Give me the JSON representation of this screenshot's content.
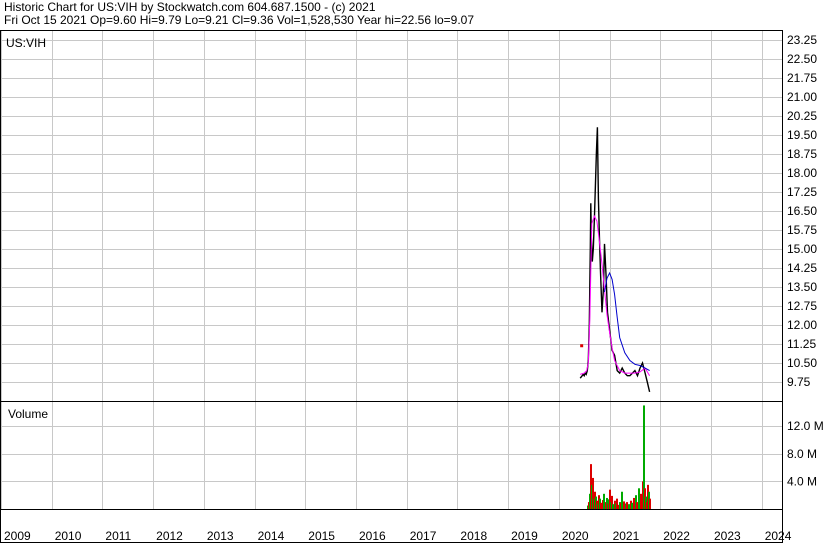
{
  "header": {
    "line1": "Historic Chart for US:VIH by Stockwatch.com 604.687.1500 - (c) 2021",
    "line2": "Fri Oct 15 2021  Op=9.60  Hi=9.79  Lo=9.21  Cl=9.36  Vol=1,528,530  Year hi=22.56  lo=9.07"
  },
  "chart_data": {
    "type": "line",
    "symbol_label": "US:VIH",
    "volume_label": "Volume",
    "x_tick_labels": [
      "2009",
      "2010",
      "2011",
      "2012",
      "2013",
      "2014",
      "2015",
      "2016",
      "2017",
      "2018",
      "2019",
      "2020",
      "2021",
      "2022",
      "2023",
      "2024"
    ],
    "y_tick_labels": [
      "23.25",
      "22.50",
      "21.75",
      "21.00",
      "20.25",
      "19.50",
      "18.75",
      "18.00",
      "17.25",
      "16.50",
      "15.75",
      "15.00",
      "14.25",
      "13.50",
      "12.75",
      "12.00",
      "11.25",
      "10.50",
      "9.75"
    ],
    "y_ticks": [
      23.25,
      22.5,
      21.75,
      21.0,
      20.25,
      19.5,
      18.75,
      18.0,
      17.25,
      16.5,
      15.75,
      15.0,
      14.25,
      13.5,
      12.75,
      12.0,
      11.25,
      10.5,
      9.75
    ],
    "ylim": [
      9.0,
      23.6
    ],
    "volume_tick_labels": [
      "12.0 M",
      "8.0 M",
      "4.0 M"
    ],
    "volume_ticks": [
      12.0,
      8.0,
      4.0
    ],
    "volume_ylim": [
      0,
      15.5
    ],
    "xlim": [
      2009.0,
      2024.4
    ],
    "grid": true,
    "colors": {
      "price": "#000000",
      "ma_short": "#ff00ff",
      "ma_long": "#0000cc",
      "volume_up": "#00aa00",
      "volume_down": "#dd0000",
      "grid": "#c8c8c8"
    },
    "series": [
      {
        "name": "price",
        "x": [
          2020.42,
          2020.44,
          2020.46,
          2020.48,
          2020.5,
          2020.52,
          2020.54,
          2020.56,
          2020.58,
          2020.6,
          2020.61,
          2020.62,
          2020.63,
          2020.64,
          2020.66,
          2020.68,
          2020.7,
          2020.72,
          2020.74,
          2020.76,
          2020.78,
          2020.8,
          2020.82,
          2020.85,
          2020.88,
          2020.9,
          2020.93,
          2020.96,
          2021.0,
          2021.05,
          2021.1,
          2021.15,
          2021.2,
          2021.25,
          2021.3,
          2021.35,
          2021.4,
          2021.45,
          2021.5,
          2021.55,
          2021.6,
          2021.65,
          2021.7,
          2021.75,
          2021.79
        ],
        "y": [
          9.9,
          9.95,
          10.0,
          10.05,
          10.0,
          10.1,
          10.05,
          10.2,
          10.6,
          12.0,
          13.5,
          15.0,
          16.8,
          15.5,
          14.5,
          15.0,
          16.2,
          17.5,
          18.8,
          19.8,
          17.0,
          15.5,
          14.2,
          12.5,
          13.5,
          15.2,
          14.0,
          12.5,
          11.8,
          11.0,
          10.8,
          10.2,
          10.1,
          10.3,
          10.1,
          10.0,
          10.0,
          10.1,
          10.2,
          10.0,
          10.3,
          10.5,
          10.1,
          9.7,
          9.36
        ]
      },
      {
        "name": "ma_short",
        "x": [
          2020.42,
          2020.5,
          2020.55,
          2020.58,
          2020.61,
          2020.65,
          2020.7,
          2020.75,
          2020.8,
          2020.85,
          2020.9,
          2020.95,
          2021.0,
          2021.05,
          2021.1,
          2021.2,
          2021.3,
          2021.4,
          2021.5,
          2021.6,
          2021.7,
          2021.79
        ],
        "y": [
          10.05,
          10.1,
          10.2,
          10.5,
          12.2,
          16.0,
          16.3,
          16.1,
          15.3,
          14.4,
          13.4,
          12.4,
          11.7,
          11.1,
          10.6,
          10.2,
          10.1,
          10.1,
          10.1,
          10.15,
          10.3,
          10.0
        ],
        "point_only_x": 2020.44,
        "point_only_y": 11.2
      },
      {
        "name": "ma_long",
        "x": [
          2020.9,
          2020.95,
          2021.0,
          2021.05,
          2021.1,
          2021.15,
          2021.2,
          2021.3,
          2021.4,
          2021.5,
          2021.6,
          2021.7,
          2021.79
        ],
        "y": [
          13.3,
          13.85,
          14.05,
          13.8,
          13.2,
          12.3,
          11.5,
          10.9,
          10.6,
          10.45,
          10.4,
          10.3,
          10.2
        ]
      }
    ],
    "volume": {
      "x": [
        2020.55,
        2020.58,
        2020.6,
        2020.62,
        2020.64,
        2020.66,
        2020.68,
        2020.7,
        2020.72,
        2020.74,
        2020.76,
        2020.78,
        2020.8,
        2020.82,
        2020.85,
        2020.88,
        2020.9,
        2020.92,
        2020.94,
        2020.96,
        2020.98,
        2021.0,
        2021.02,
        2021.05,
        2021.08,
        2021.1,
        2021.12,
        2021.15,
        2021.18,
        2021.2,
        2021.23,
        2021.26,
        2021.3,
        2021.33,
        2021.36,
        2021.4,
        2021.43,
        2021.46,
        2021.5,
        2021.53,
        2021.56,
        2021.6,
        2021.63,
        2021.66,
        2021.68,
        2021.7,
        2021.72,
        2021.74,
        2021.76,
        2021.78
      ],
      "values": [
        0.5,
        1.0,
        2.2,
        6.5,
        3.5,
        4.5,
        1.5,
        2.5,
        1.8,
        1.2,
        0.8,
        2.0,
        1.5,
        0.9,
        1.3,
        2.2,
        1.0,
        1.6,
        0.8,
        1.4,
        2.8,
        1.0,
        1.9,
        0.7,
        1.2,
        0.8,
        1.5,
        0.6,
        1.0,
        0.9,
        2.5,
        1.1,
        0.8,
        1.0,
        0.7,
        1.2,
        0.9,
        1.6,
        2.0,
        1.0,
        3.0,
        2.2,
        4.0,
        15.0,
        3.0,
        1.8,
        1.0,
        3.5,
        2.5,
        1.5
      ],
      "up": [
        true,
        false,
        true,
        false,
        true,
        false,
        true,
        false,
        true,
        false,
        true,
        false,
        true,
        false,
        false,
        true,
        false,
        true,
        false,
        true,
        false,
        true,
        false,
        true,
        false,
        true,
        false,
        false,
        true,
        false,
        true,
        false,
        true,
        false,
        true,
        false,
        true,
        false,
        true,
        false,
        true,
        false,
        false,
        true,
        false,
        true,
        false,
        false,
        true,
        false
      ]
    }
  }
}
